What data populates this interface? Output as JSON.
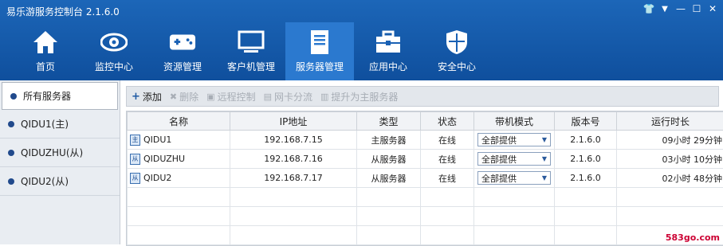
{
  "app": {
    "title": "易乐游服务控制台 2.1.6.0"
  },
  "window_controls": [
    {
      "name": "skin-icon",
      "glyph": "👕"
    },
    {
      "name": "dropdown-icon",
      "glyph": "▼"
    },
    {
      "name": "minimize-icon",
      "glyph": "—"
    },
    {
      "name": "maximize-icon",
      "glyph": "☐"
    },
    {
      "name": "close-icon",
      "glyph": "✕"
    }
  ],
  "nav": [
    {
      "label": "首页",
      "icon": "home-icon"
    },
    {
      "label": "监控中心",
      "icon": "eye-icon"
    },
    {
      "label": "资源管理",
      "icon": "gamepad-icon"
    },
    {
      "label": "客户机管理",
      "icon": "monitor-icon"
    },
    {
      "label": "服务器管理",
      "icon": "server-icon",
      "active": true
    },
    {
      "label": "应用中心",
      "icon": "toolbox-icon"
    },
    {
      "label": "安全中心",
      "icon": "shield-icon"
    }
  ],
  "sidebar": {
    "items": [
      {
        "label": "所有服务器",
        "active": true
      },
      {
        "label": "QIDU1(主)"
      },
      {
        "label": "QIDUZHU(从)"
      },
      {
        "label": "QIDU2(从)"
      }
    ]
  },
  "toolbar": {
    "add": "添加",
    "delete": "删除",
    "remote": "远程控制",
    "nic": "网卡分流",
    "promote": "提升为主服务器"
  },
  "table": {
    "headers": [
      "名称",
      "IP地址",
      "类型",
      "状态",
      "带机模式",
      "版本号",
      "运行时长"
    ],
    "rows": [
      {
        "icon": "主",
        "name": "QIDU1",
        "ip": "192.168.7.15",
        "type": "主服务器",
        "status": "在线",
        "mode": "全部提供",
        "version": "2.1.6.0",
        "uptime": "09小时 29分钟"
      },
      {
        "icon": "从",
        "name": "QIDUZHU",
        "ip": "192.168.7.16",
        "type": "从服务器",
        "status": "在线",
        "mode": "全部提供",
        "version": "2.1.6.0",
        "uptime": "03小时 10分钟"
      },
      {
        "icon": "从",
        "name": "QIDU2",
        "ip": "192.168.7.17",
        "type": "从服务器",
        "status": "在线",
        "mode": "全部提供",
        "version": "2.1.6.0",
        "uptime": "02小时 48分钟"
      }
    ]
  },
  "watermark": "583go.com"
}
